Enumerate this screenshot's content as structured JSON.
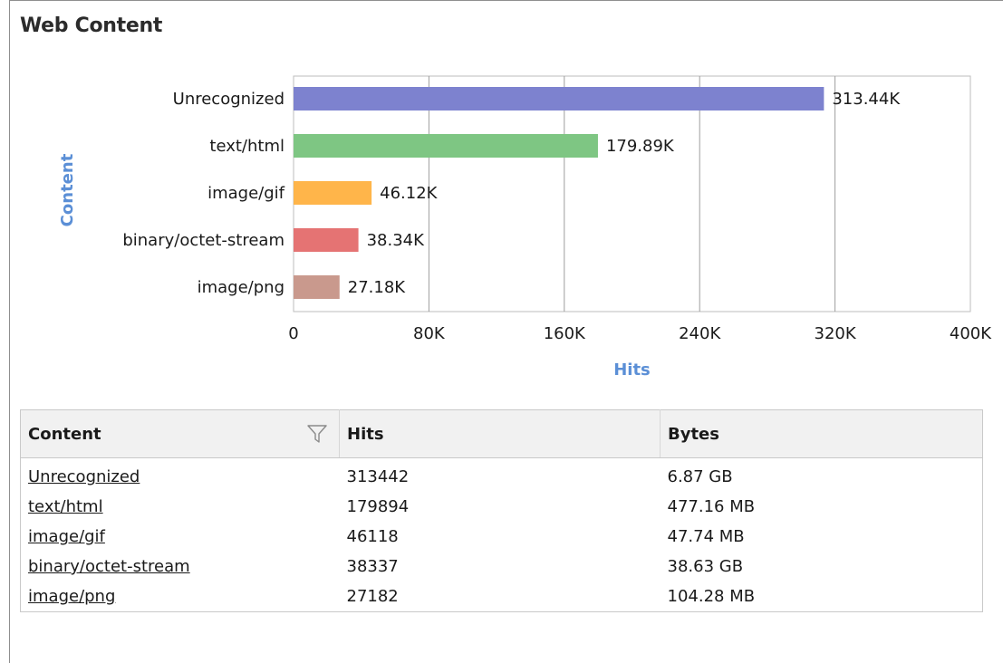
{
  "panel": {
    "title": "Web Content"
  },
  "chart_data": {
    "type": "bar",
    "orientation": "horizontal",
    "categories": [
      "Unrecognized",
      "text/html",
      "image/gif",
      "binary/octet-stream",
      "image/png"
    ],
    "values": [
      313442,
      179894,
      46118,
      38337,
      27182
    ],
    "data_labels": [
      "313.44K",
      "179.89K",
      "46.12K",
      "38.34K",
      "27.18K"
    ],
    "colors": [
      "#7d82cf",
      "#7ec683",
      "#ffb54a",
      "#e57373",
      "#c9998d"
    ],
    "xlabel": "Hits",
    "ylabel": "Content",
    "xlim": [
      0,
      400000
    ],
    "x_ticks": [
      0,
      80000,
      160000,
      240000,
      320000,
      400000
    ],
    "x_tick_labels": [
      "0",
      "80K",
      "160K",
      "240K",
      "320K",
      "400K"
    ],
    "grid": true,
    "axis_title_color": "#5b8fd6"
  },
  "table": {
    "headers": [
      "Content",
      "Hits",
      "Bytes"
    ],
    "rows": [
      {
        "content": "Unrecognized",
        "hits": "313442",
        "bytes": "6.87 GB"
      },
      {
        "content": "text/html",
        "hits": "179894",
        "bytes": "477.16 MB"
      },
      {
        "content": "image/gif",
        "hits": "46118",
        "bytes": "47.74 MB"
      },
      {
        "content": "binary/octet-stream",
        "hits": "38337",
        "bytes": "38.63 GB"
      },
      {
        "content": "image/png",
        "hits": "27182",
        "bytes": "104.28 MB"
      }
    ],
    "filter_icon": "filter-icon"
  }
}
